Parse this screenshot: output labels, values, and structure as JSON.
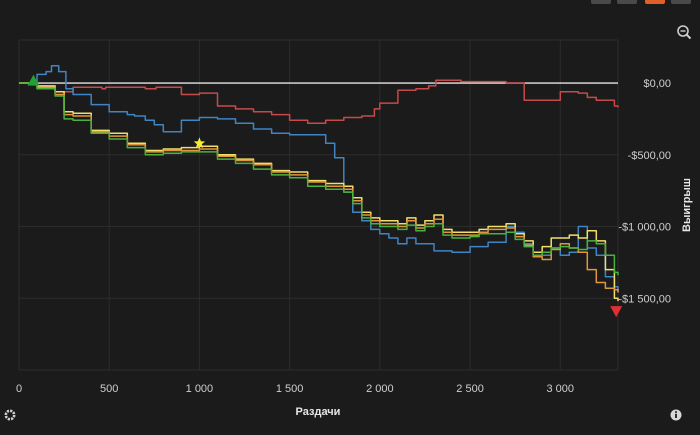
{
  "window": {
    "tab_accents": [
      {
        "name": "tab-1",
        "color": "#4a4a4a"
      },
      {
        "name": "tab-2",
        "color": "#4a4a4a"
      },
      {
        "name": "tab-3",
        "color": "#e0602a"
      },
      {
        "name": "tab-4",
        "color": "#4a4a4a"
      }
    ],
    "icons": {
      "zoom": "zoom-out-icon",
      "settings": "gear-icon",
      "info": "info-icon"
    }
  },
  "chart_data": {
    "type": "line",
    "xlabel": "Раздачи",
    "ylabel": "Выигрыш",
    "xlim": [
      0,
      3320
    ],
    "ylim": [
      -2000,
      300
    ],
    "x_ticks": [
      0,
      500,
      1000,
      1500,
      2000,
      2500,
      3000
    ],
    "x_tick_labels": [
      "0",
      "500",
      "1 000",
      "1 500",
      "2 000",
      "2 500",
      "3 000"
    ],
    "y_ticks": [
      0,
      -500,
      -1000,
      -1500
    ],
    "y_tick_labels": [
      "$0,00",
      "-$500,00",
      "-$1 000,00",
      "-$1 500,00"
    ],
    "zero_line": 0,
    "grid": true,
    "series": [
      {
        "color": "#c64a4a",
        "points": [
          [
            0,
            0
          ],
          [
            100,
            -30
          ],
          [
            200,
            -60
          ],
          [
            300,
            -30
          ],
          [
            460,
            -40
          ],
          [
            480,
            -30
          ],
          [
            600,
            -30
          ],
          [
            700,
            -40
          ],
          [
            760,
            -30
          ],
          [
            860,
            -30
          ],
          [
            900,
            -80
          ],
          [
            1000,
            -70
          ],
          [
            1100,
            -160
          ],
          [
            1200,
            -180
          ],
          [
            1300,
            -200
          ],
          [
            1400,
            -220
          ],
          [
            1500,
            -260
          ],
          [
            1600,
            -280
          ],
          [
            1700,
            -260
          ],
          [
            1800,
            -240
          ],
          [
            1900,
            -230
          ],
          [
            1970,
            -180
          ],
          [
            2000,
            -140
          ],
          [
            2100,
            -50
          ],
          [
            2200,
            -40
          ],
          [
            2270,
            -20
          ],
          [
            2310,
            20
          ],
          [
            2450,
            10
          ],
          [
            2600,
            10
          ],
          [
            2700,
            0
          ],
          [
            2760,
            0
          ],
          [
            2800,
            -120
          ],
          [
            3000,
            -60
          ],
          [
            3100,
            -70
          ],
          [
            3150,
            -100
          ],
          [
            3200,
            -120
          ],
          [
            3300,
            -160
          ],
          [
            3320,
            -170
          ]
        ]
      },
      {
        "color": "#3f84c4",
        "points": [
          [
            0,
            0
          ],
          [
            100,
            60
          ],
          [
            150,
            80
          ],
          [
            180,
            120
          ],
          [
            220,
            80
          ],
          [
            260,
            -40
          ],
          [
            300,
            -80
          ],
          [
            400,
            -150
          ],
          [
            500,
            -200
          ],
          [
            600,
            -220
          ],
          [
            640,
            -230
          ],
          [
            700,
            -260
          ],
          [
            750,
            -290
          ],
          [
            800,
            -340
          ],
          [
            900,
            -260
          ],
          [
            1000,
            -240
          ],
          [
            1100,
            -250
          ],
          [
            1200,
            -280
          ],
          [
            1300,
            -320
          ],
          [
            1400,
            -350
          ],
          [
            1500,
            -360
          ],
          [
            1600,
            -360
          ],
          [
            1700,
            -420
          ],
          [
            1750,
            -520
          ],
          [
            1800,
            -760
          ],
          [
            1850,
            -900
          ],
          [
            1900,
            -960
          ],
          [
            1950,
            -1020
          ],
          [
            2000,
            -1050
          ],
          [
            2050,
            -1080
          ],
          [
            2100,
            -1120
          ],
          [
            2150,
            -1080
          ],
          [
            2200,
            -1120
          ],
          [
            2300,
            -1170
          ],
          [
            2400,
            -1180
          ],
          [
            2500,
            -1140
          ],
          [
            2600,
            -1110
          ],
          [
            2700,
            -1000
          ],
          [
            2750,
            -1040
          ],
          [
            2800,
            -1120
          ],
          [
            2850,
            -1180
          ],
          [
            2900,
            -1200
          ],
          [
            2950,
            -1150
          ],
          [
            3000,
            -1200
          ],
          [
            3050,
            -1180
          ],
          [
            3100,
            -1000
          ],
          [
            3150,
            -1150
          ],
          [
            3200,
            -1200
          ],
          [
            3250,
            -1350
          ],
          [
            3300,
            -1420
          ],
          [
            3320,
            -1460
          ]
        ]
      },
      {
        "color": "#f2df6a",
        "points": [
          [
            0,
            0
          ],
          [
            100,
            -20
          ],
          [
            200,
            -60
          ],
          [
            250,
            -200
          ],
          [
            300,
            -210
          ],
          [
            400,
            -330
          ],
          [
            500,
            -350
          ],
          [
            600,
            -420
          ],
          [
            700,
            -470
          ],
          [
            800,
            -460
          ],
          [
            900,
            -450
          ],
          [
            1000,
            -440
          ],
          [
            1100,
            -500
          ],
          [
            1200,
            -530
          ],
          [
            1300,
            -560
          ],
          [
            1400,
            -610
          ],
          [
            1500,
            -620
          ],
          [
            1600,
            -680
          ],
          [
            1700,
            -700
          ],
          [
            1800,
            -720
          ],
          [
            1850,
            -800
          ],
          [
            1900,
            -900
          ],
          [
            1950,
            -940
          ],
          [
            2000,
            -960
          ],
          [
            2100,
            -980
          ],
          [
            2150,
            -940
          ],
          [
            2200,
            -990
          ],
          [
            2250,
            -960
          ],
          [
            2300,
            -920
          ],
          [
            2350,
            -1020
          ],
          [
            2400,
            -1040
          ],
          [
            2500,
            -1040
          ],
          [
            2550,
            -1020
          ],
          [
            2600,
            -1000
          ],
          [
            2700,
            -980
          ],
          [
            2750,
            -1050
          ],
          [
            2800,
            -1100
          ],
          [
            2850,
            -1180
          ],
          [
            2900,
            -1140
          ],
          [
            2950,
            -1080
          ],
          [
            3000,
            -1080
          ],
          [
            3050,
            -1060
          ],
          [
            3100,
            -1080
          ],
          [
            3150,
            -1030
          ],
          [
            3200,
            -1100
          ],
          [
            3250,
            -1300
          ],
          [
            3300,
            -1500
          ],
          [
            3320,
            -1520
          ]
        ]
      },
      {
        "color": "#e0963c",
        "points": [
          [
            0,
            0
          ],
          [
            100,
            -30
          ],
          [
            200,
            -80
          ],
          [
            250,
            -220
          ],
          [
            300,
            -230
          ],
          [
            400,
            -340
          ],
          [
            500,
            -370
          ],
          [
            600,
            -430
          ],
          [
            700,
            -480
          ],
          [
            800,
            -470
          ],
          [
            900,
            -470
          ],
          [
            1000,
            -460
          ],
          [
            1100,
            -510
          ],
          [
            1200,
            -540
          ],
          [
            1300,
            -570
          ],
          [
            1400,
            -620
          ],
          [
            1500,
            -640
          ],
          [
            1600,
            -690
          ],
          [
            1700,
            -720
          ],
          [
            1800,
            -740
          ],
          [
            1850,
            -820
          ],
          [
            1900,
            -920
          ],
          [
            1950,
            -960
          ],
          [
            2000,
            -980
          ],
          [
            2100,
            -1000
          ],
          [
            2150,
            -960
          ],
          [
            2200,
            -1010
          ],
          [
            2250,
            -980
          ],
          [
            2300,
            -950
          ],
          [
            2350,
            -1040
          ],
          [
            2400,
            -1060
          ],
          [
            2500,
            -1060
          ],
          [
            2550,
            -1040
          ],
          [
            2600,
            -1020
          ],
          [
            2700,
            -1010
          ],
          [
            2750,
            -1070
          ],
          [
            2800,
            -1130
          ],
          [
            2850,
            -1210
          ],
          [
            2900,
            -1230
          ],
          [
            2950,
            -1160
          ],
          [
            3000,
            -1120
          ],
          [
            3050,
            -1150
          ],
          [
            3100,
            -1180
          ],
          [
            3150,
            -1300
          ],
          [
            3200,
            -1390
          ],
          [
            3250,
            -1430
          ],
          [
            3300,
            -1440
          ],
          [
            3320,
            -1460
          ]
        ]
      },
      {
        "color": "#49b23c",
        "points": [
          [
            0,
            0
          ],
          [
            100,
            -40
          ],
          [
            200,
            -90
          ],
          [
            250,
            -250
          ],
          [
            300,
            -260
          ],
          [
            400,
            -350
          ],
          [
            500,
            -390
          ],
          [
            600,
            -450
          ],
          [
            700,
            -500
          ],
          [
            800,
            -490
          ],
          [
            900,
            -480
          ],
          [
            1000,
            -480
          ],
          [
            1100,
            -530
          ],
          [
            1200,
            -560
          ],
          [
            1300,
            -600
          ],
          [
            1400,
            -640
          ],
          [
            1500,
            -660
          ],
          [
            1600,
            -720
          ],
          [
            1700,
            -740
          ],
          [
            1800,
            -760
          ],
          [
            1850,
            -840
          ],
          [
            1900,
            -940
          ],
          [
            1950,
            -980
          ],
          [
            2000,
            -1000
          ],
          [
            2100,
            -1020
          ],
          [
            2150,
            -990
          ],
          [
            2200,
            -1030
          ],
          [
            2250,
            -1000
          ],
          [
            2300,
            -980
          ],
          [
            2350,
            -1060
          ],
          [
            2400,
            -1080
          ],
          [
            2500,
            -1070
          ],
          [
            2550,
            -1050
          ],
          [
            2600,
            -1050
          ],
          [
            2700,
            -1040
          ],
          [
            2750,
            -1090
          ],
          [
            2800,
            -1140
          ],
          [
            2850,
            -1200
          ],
          [
            2900,
            -1180
          ],
          [
            2950,
            -1150
          ],
          [
            3000,
            -1140
          ],
          [
            3050,
            -1150
          ],
          [
            3100,
            -1160
          ],
          [
            3150,
            -1100
          ],
          [
            3200,
            -1120
          ],
          [
            3250,
            -1200
          ],
          [
            3300,
            -1320
          ],
          [
            3320,
            -1340
          ]
        ]
      }
    ],
    "markers": [
      {
        "kind": "triangle-up",
        "color": "#22a034",
        "x": 80,
        "y": 10
      },
      {
        "kind": "star",
        "color": "#f5ec2a",
        "x": 1000,
        "y": -420
      },
      {
        "kind": "triangle-down",
        "color": "#e23030",
        "x": 3310,
        "y": -1590
      }
    ]
  }
}
